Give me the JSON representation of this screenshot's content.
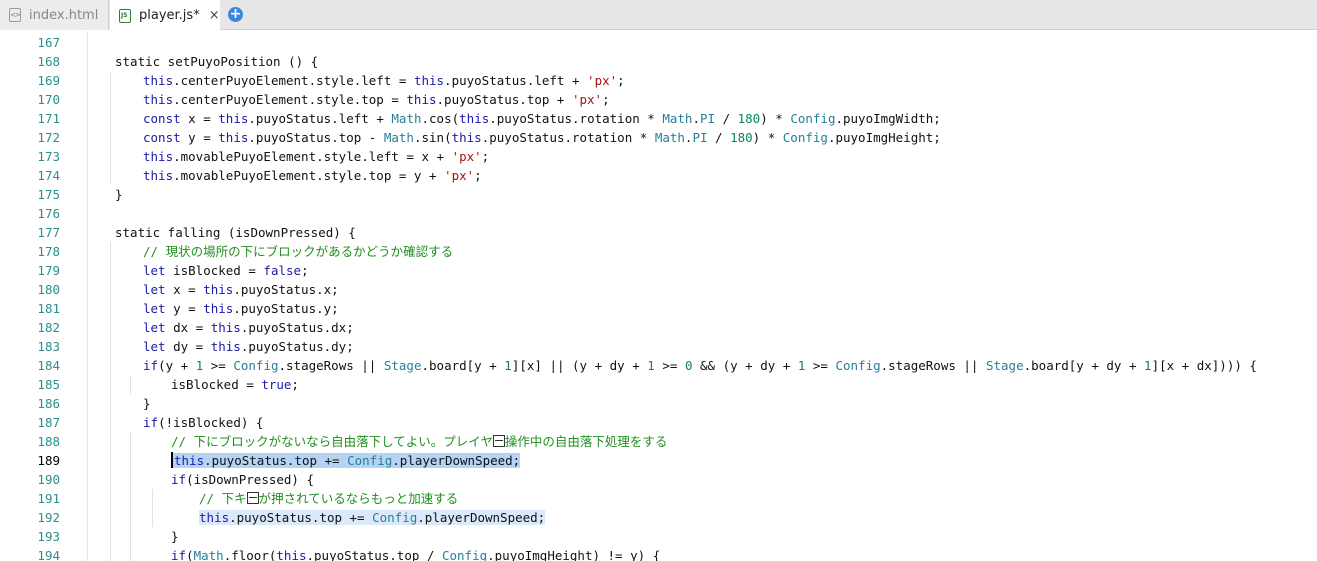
{
  "tabs": [
    {
      "label": "index.html",
      "icon": "html-file-icon",
      "active": false
    },
    {
      "label": "player.js*",
      "icon": "js-file-icon",
      "active": true,
      "close": "×"
    }
  ],
  "new_tab": "+",
  "editor": {
    "current_line": 189,
    "lines": [
      {
        "n": "167",
        "indent": 0,
        "tokens": []
      },
      {
        "n": "168",
        "indent": 1,
        "tokens": [
          [
            "p",
            "static setPuyoPosition () {"
          ]
        ]
      },
      {
        "n": "169",
        "indent": 2,
        "tokens": [
          [
            "kw",
            "this"
          ],
          [
            "p",
            ".centerPuyoElement.style.left = "
          ],
          [
            "kw",
            "this"
          ],
          [
            "p",
            ".puyoStatus.left + "
          ],
          [
            "str",
            "'px'"
          ],
          [
            "p",
            ";"
          ]
        ]
      },
      {
        "n": "170",
        "indent": 2,
        "tokens": [
          [
            "kw",
            "this"
          ],
          [
            "p",
            ".centerPuyoElement.style.top = "
          ],
          [
            "kw",
            "this"
          ],
          [
            "p",
            ".puyoStatus.top + "
          ],
          [
            "str",
            "'px'"
          ],
          [
            "p",
            ";"
          ]
        ]
      },
      {
        "n": "171",
        "indent": 2,
        "tokens": [
          [
            "kw",
            "const"
          ],
          [
            "p",
            " x = "
          ],
          [
            "kw",
            "this"
          ],
          [
            "p",
            ".puyoStatus.left + "
          ],
          [
            "cls",
            "Math"
          ],
          [
            "p",
            ".cos("
          ],
          [
            "kw",
            "this"
          ],
          [
            "p",
            ".puyoStatus.rotation * "
          ],
          [
            "cls",
            "Math"
          ],
          [
            "p",
            "."
          ],
          [
            "cls",
            "PI"
          ],
          [
            "p",
            " / "
          ],
          [
            "num",
            "180"
          ],
          [
            "p",
            ") * "
          ],
          [
            "cls",
            "Config"
          ],
          [
            "p",
            ".puyoImgWidth;"
          ]
        ]
      },
      {
        "n": "172",
        "indent": 2,
        "tokens": [
          [
            "kw",
            "const"
          ],
          [
            "p",
            " y = "
          ],
          [
            "kw",
            "this"
          ],
          [
            "p",
            ".puyoStatus.top - "
          ],
          [
            "cls",
            "Math"
          ],
          [
            "p",
            ".sin("
          ],
          [
            "kw",
            "this"
          ],
          [
            "p",
            ".puyoStatus.rotation * "
          ],
          [
            "cls",
            "Math"
          ],
          [
            "p",
            "."
          ],
          [
            "cls",
            "PI"
          ],
          [
            "p",
            " / "
          ],
          [
            "num",
            "180"
          ],
          [
            "p",
            ") * "
          ],
          [
            "cls",
            "Config"
          ],
          [
            "p",
            ".puyoImgHeight;"
          ]
        ]
      },
      {
        "n": "173",
        "indent": 2,
        "tokens": [
          [
            "kw",
            "this"
          ],
          [
            "p",
            ".movablePuyoElement.style.left = x + "
          ],
          [
            "str",
            "'px'"
          ],
          [
            "p",
            ";"
          ]
        ]
      },
      {
        "n": "174",
        "indent": 2,
        "tokens": [
          [
            "kw",
            "this"
          ],
          [
            "p",
            ".movablePuyoElement.style.top = y + "
          ],
          [
            "str",
            "'px'"
          ],
          [
            "p",
            ";"
          ]
        ]
      },
      {
        "n": "175",
        "indent": 1,
        "tokens": [
          [
            "p",
            "}"
          ]
        ]
      },
      {
        "n": "176",
        "indent": 0,
        "tokens": []
      },
      {
        "n": "177",
        "indent": 1,
        "tokens": [
          [
            "p",
            "static falling (isDownPressed) {"
          ]
        ]
      },
      {
        "n": "178",
        "indent": 2,
        "tokens": [
          [
            "cmt",
            "// 現状の場所の下にブロックがあるかどうか確認する"
          ]
        ]
      },
      {
        "n": "179",
        "indent": 2,
        "tokens": [
          [
            "kw",
            "let"
          ],
          [
            "p",
            " isBlocked = "
          ],
          [
            "kw",
            "false"
          ],
          [
            "p",
            ";"
          ]
        ]
      },
      {
        "n": "180",
        "indent": 2,
        "tokens": [
          [
            "kw",
            "let"
          ],
          [
            "p",
            " x = "
          ],
          [
            "kw",
            "this"
          ],
          [
            "p",
            ".puyoStatus.x;"
          ]
        ]
      },
      {
        "n": "181",
        "indent": 2,
        "tokens": [
          [
            "kw",
            "let"
          ],
          [
            "p",
            " y = "
          ],
          [
            "kw",
            "this"
          ],
          [
            "p",
            ".puyoStatus.y;"
          ]
        ]
      },
      {
        "n": "182",
        "indent": 2,
        "tokens": [
          [
            "kw",
            "let"
          ],
          [
            "p",
            " dx = "
          ],
          [
            "kw",
            "this"
          ],
          [
            "p",
            ".puyoStatus.dx;"
          ]
        ]
      },
      {
        "n": "183",
        "indent": 2,
        "tokens": [
          [
            "kw",
            "let"
          ],
          [
            "p",
            " dy = "
          ],
          [
            "kw",
            "this"
          ],
          [
            "p",
            ".puyoStatus.dy;"
          ]
        ]
      },
      {
        "n": "184",
        "indent": 2,
        "tokens": [
          [
            "kw",
            "if"
          ],
          [
            "p",
            "(y + "
          ],
          [
            "num",
            "1"
          ],
          [
            "p",
            " >= "
          ],
          [
            "cls",
            "Config"
          ],
          [
            "p",
            ".stageRows || "
          ],
          [
            "cls",
            "Stage"
          ],
          [
            "p",
            ".board[y + "
          ],
          [
            "num",
            "1"
          ],
          [
            "p",
            "][x] || (y + dy + "
          ],
          [
            "num",
            "1"
          ],
          [
            "p",
            " >= "
          ],
          [
            "num",
            "0"
          ],
          [
            "p",
            " && (y + dy + "
          ],
          [
            "num",
            "1"
          ],
          [
            "p",
            " >= "
          ],
          [
            "cls",
            "Config"
          ],
          [
            "p",
            ".stageRows || "
          ],
          [
            "cls",
            "Stage"
          ],
          [
            "p",
            ".board[y + dy + "
          ],
          [
            "num",
            "1"
          ],
          [
            "p",
            "][x + dx]))) {"
          ]
        ]
      },
      {
        "n": "185",
        "indent": 3,
        "tokens": [
          [
            "p",
            "isBlocked = "
          ],
          [
            "kw",
            "true"
          ],
          [
            "p",
            ";"
          ]
        ]
      },
      {
        "n": "186",
        "indent": 2,
        "tokens": [
          [
            "p",
            "}"
          ]
        ]
      },
      {
        "n": "187",
        "indent": 2,
        "tokens": [
          [
            "kw",
            "if"
          ],
          [
            "p",
            "(!isBlocked) {"
          ]
        ]
      },
      {
        "n": "188",
        "indent": 3,
        "tokens": [
          [
            "cmt",
            "// 下にブロックがないなら自由落下してよい。プレイヤ"
          ],
          [
            "box",
            ""
          ],
          [
            "cmt",
            "操作中の自由落下処理をする"
          ]
        ]
      },
      {
        "n": "189",
        "indent": 3,
        "cursor": true,
        "sel": "sel",
        "tokens": [
          [
            "kw",
            "this"
          ],
          [
            "p",
            ".puyoStatus.top += "
          ],
          [
            "cls",
            "Config"
          ],
          [
            "p",
            ".playerDownSpeed;"
          ]
        ]
      },
      {
        "n": "190",
        "indent": 3,
        "tokens": [
          [
            "kw",
            "if"
          ],
          [
            "p",
            "(isDownPressed) {"
          ]
        ]
      },
      {
        "n": "191",
        "indent": 4,
        "tokens": [
          [
            "cmt",
            "// 下キ"
          ],
          [
            "box",
            ""
          ],
          [
            "cmt",
            "が押されているならもっと加速する"
          ]
        ]
      },
      {
        "n": "192",
        "indent": 4,
        "sel": "sel2",
        "tokens": [
          [
            "kw",
            "this"
          ],
          [
            "p",
            ".puyoStatus.top += "
          ],
          [
            "cls",
            "Config"
          ],
          [
            "p",
            ".playerDownSpeed;"
          ]
        ]
      },
      {
        "n": "193",
        "indent": 3,
        "tokens": [
          [
            "p",
            "}"
          ]
        ]
      },
      {
        "n": "194",
        "indent": 3,
        "tokens": [
          [
            "kw",
            "if"
          ],
          [
            "p",
            "("
          ],
          [
            "cls",
            "Math"
          ],
          [
            "p",
            ".floor("
          ],
          [
            "kw",
            "this"
          ],
          [
            "p",
            ".puyoStatus.top / "
          ],
          [
            "cls",
            "Config"
          ],
          [
            "p",
            ".puyoImgHeight) != y) {"
          ]
        ]
      }
    ]
  }
}
